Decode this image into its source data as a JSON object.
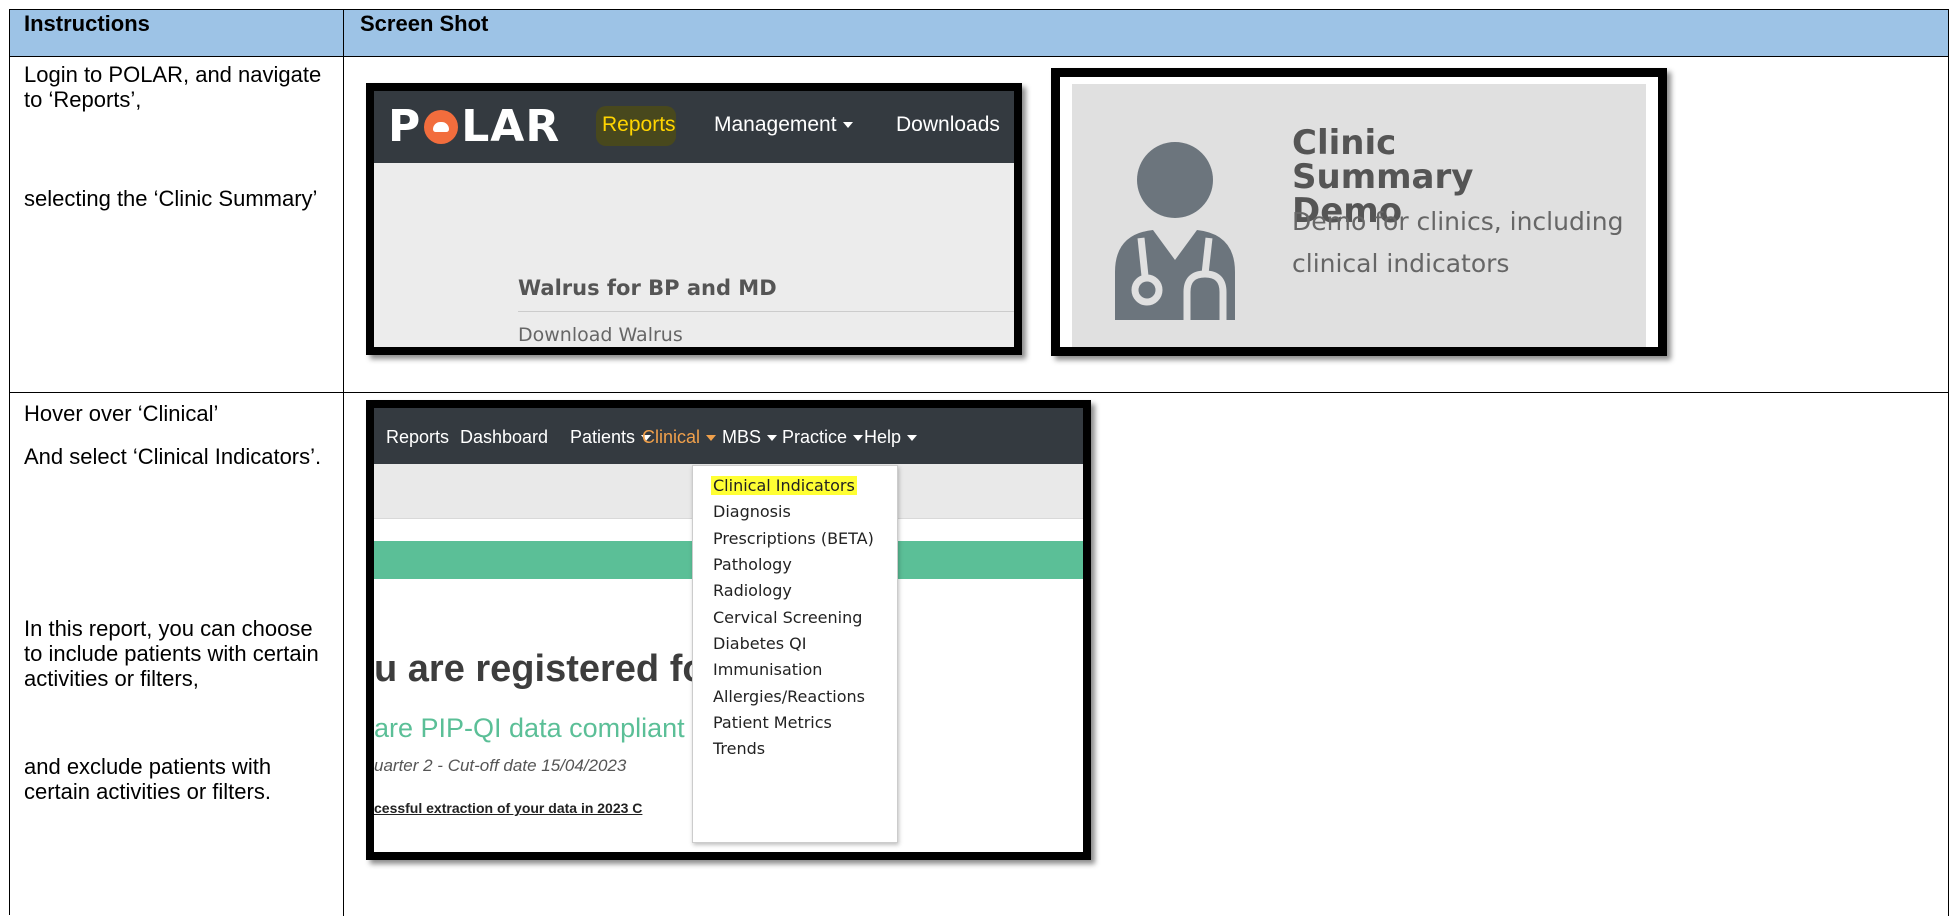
{
  "table": {
    "header": {
      "col1": "Instructions",
      "col2": "Screen Shot"
    },
    "row1": {
      "instructions": [
        "Login to POLAR, and navigate to ‘Reports’,",
        "selecting the ‘Clinic Summary’"
      ]
    },
    "row2": {
      "instructions": [
        "Hover over ‘Clinical’",
        "And select ‘Clinical Indicators’.",
        "In this report, you can choose to include patients with certain activities or filters,",
        "and exclude patients with certain activities or filters."
      ]
    }
  },
  "shot1": {
    "logo_text_left": "P",
    "logo_text_right": "LAR",
    "nav": {
      "reports": "Reports",
      "management": "Management",
      "downloads": "Downloads"
    },
    "walrus_title": "Walrus for BP and MD",
    "walrus_link": "Download Walrus",
    "highlight_color": "#ffd400"
  },
  "shot2": {
    "card_title": "Clinic Summary Demo",
    "card_description": "Demo for clinics, including clinical indicators",
    "icon": "doctor-icon"
  },
  "shot3": {
    "nav": [
      "Reports",
      "Dashboard",
      "Patients",
      "Clinical",
      "MBS",
      "Practice",
      "Help"
    ],
    "active_nav": "Clinical",
    "dropdown_items": [
      "Clinical Indicators",
      "Diagnosis",
      "Prescriptions (BETA)",
      "Pathology",
      "Radiology",
      "Cervical Screening",
      "Diabetes QI",
      "Immunisation",
      "Allergies/Reactions",
      "Patient Metrics",
      "Trends"
    ],
    "highlighted_item": "Clinical Indicators",
    "registered_text": "u are registered fo",
    "pip_text": "are PIP-QI data compliant",
    "quarter_text": "uarter 2 - Cut-off date 15/04/2023",
    "extract_text": "cessful extraction of your data in 2023 C",
    "accent_color": "#5bbf97"
  }
}
